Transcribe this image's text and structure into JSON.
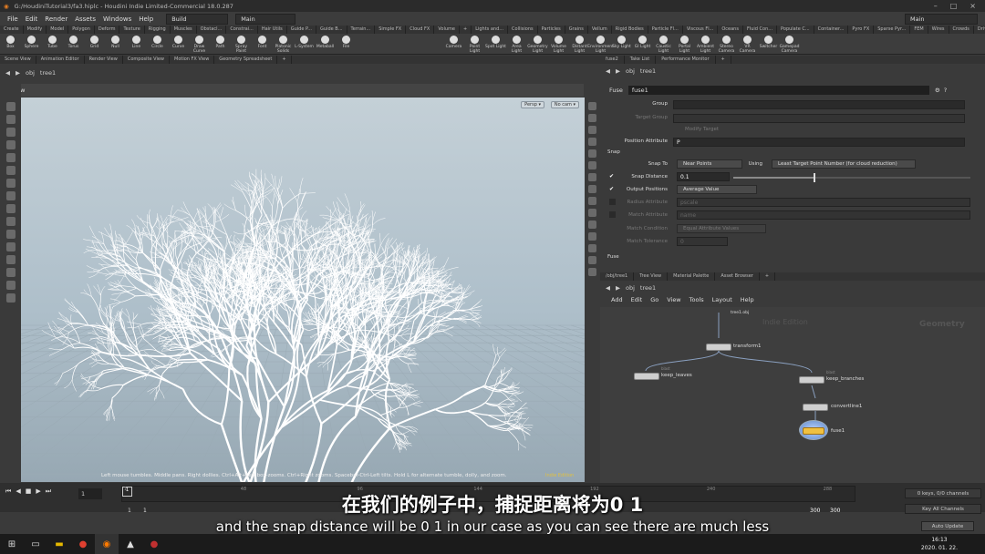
{
  "window": {
    "title": "G:/HoudiniTutorial3/fa3.hiplc - Houdini Indie Limited-Commercial 18.0.287",
    "controls": [
      "–",
      "□",
      "×"
    ]
  },
  "menu": {
    "items": [
      "File",
      "Edit",
      "Render",
      "Assets",
      "Windows",
      "Help"
    ],
    "build": "Build",
    "desktop": "Main",
    "right_desktop": "Main"
  },
  "shelf_tabs": [
    "Create",
    "Modify",
    "Model",
    "Polygon",
    "Deform",
    "Texture",
    "Rigging",
    "Muscles",
    "Obstacl...",
    "Constrai...",
    "Hair Utils",
    "Guide P...",
    "Guide B...",
    "Terrain...",
    "Simple FX",
    "Cloud FX",
    "Volume",
    "+",
    "Lights and...",
    "Collisions",
    "Particles",
    "Grains",
    "Vellum",
    "Rigid Bodies",
    "Particle Fl...",
    "Viscous Fl...",
    "Oceans",
    "Fluid Con...",
    "Populate C...",
    "Container...",
    "Pyro FX",
    "Sparse Pyr...",
    "FEM",
    "Wires",
    "Crowds",
    "Drive Sim..."
  ],
  "shelf_tools_left": [
    "Box",
    "Sphere",
    "Tube",
    "Torus",
    "Grid",
    "Null",
    "Line",
    "Circle",
    "Curve",
    "Draw Curve",
    "Path",
    "Spray Paint",
    "Font",
    "Platonic Solids",
    "L-System",
    "Metaball",
    "File"
  ],
  "shelf_tools_right": [
    "Camera",
    "Point Light",
    "Spot Light",
    "Area Light",
    "Geometry Light",
    "Volume Light",
    "Distant Light",
    "Environment Light",
    "Sky Light",
    "GI Light",
    "Caustic Light",
    "Portal Light",
    "Ambient Light",
    "Stereo Camera",
    "VR Camera",
    "Switcher",
    "Gamepad Camera"
  ],
  "viewer": {
    "tabs": [
      "Scene View",
      "Animation Editor",
      "Render View",
      "Composite View",
      "Motion FX View",
      "Geometry Spreadsheet",
      "+"
    ],
    "path": [
      "obj",
      "tree1"
    ],
    "title": "View",
    "persp": "Persp ▾",
    "cam": "No cam ▾",
    "hint": "Left mouse tumbles. Middle pans. Right dollies. Ctrl+Alt+Left box-zooms. Ctrl+Right zooms. Spacebar-Ctrl-Left tilts. Hold L for alternate tumble, dolly, and zoom.",
    "edition": "Indie Edition"
  },
  "params": {
    "tabs": [
      "fuse2",
      "Take List",
      "Performance Monitor",
      "+"
    ],
    "path": [
      "obj",
      "tree1"
    ],
    "node_type": "Fuse",
    "node_name": "fuse1",
    "rows": [
      {
        "label": "Group",
        "value": "",
        "dim": false
      },
      {
        "label": "Target Group",
        "value": "",
        "dim": true
      },
      {
        "label": "Modify Target",
        "value": "",
        "dim": true
      },
      {
        "label": "Position Attribute",
        "value": "P",
        "dim": false
      }
    ],
    "snap_section": "Snap",
    "snap_to_label": "Snap To",
    "snap_to": "Near Points",
    "using_label": "Using",
    "using": "Least Target Point Number (for cloud reduction)",
    "snap_distance_label": "Snap Distance",
    "snap_distance": "0.1",
    "snap_distance_fraction": 0.34,
    "output_positions_label": "Output Positions",
    "output_positions": "Average Value",
    "radius_label": "Radius Attribute",
    "radius": "pscale",
    "match_label": "Match Attribute",
    "match": "name",
    "match_cond_label": "Match Condition",
    "match_cond": "Equal Attribute Values",
    "match_tol_label": "Match Tolerance",
    "match_tol": "0",
    "fuse_section": "Fuse"
  },
  "network": {
    "tabs": [
      "/obj/tree1",
      "Tree View",
      "Material Palette",
      "Asset Browser",
      "+"
    ],
    "path": [
      "obj",
      "tree1"
    ],
    "menu": [
      "Add",
      "Edit",
      "Go",
      "View",
      "Tools",
      "Layout",
      "Help"
    ],
    "watermark1": "Indie Edition",
    "watermark2": "Geometry",
    "nodes": {
      "top": "tree1.obj",
      "transform": "transform1",
      "leaves": "keep_leaves",
      "branches": "keep_branches",
      "convert": "convertline1",
      "fuse": "fuse1",
      "leaves_type": "blast",
      "branches_type": "blast"
    }
  },
  "timeline": {
    "frame": "1",
    "start": "1",
    "end": "1",
    "end_frame": "300",
    "end_frame2": "300",
    "ticks": [
      "1",
      "48",
      "96",
      "144",
      "192",
      "240",
      "288"
    ],
    "keys": "0 keys, 0/0 channels",
    "key_channels": "Key All Channels",
    "auto_update": "Auto Update"
  },
  "subtitles": {
    "zh": "在我们的例子中，捕捉距离将为0 1",
    "en": "and the snap distance will be 0 1 in our case as you can see there are much less"
  },
  "taskbar": {
    "time": "16:13",
    "date": "2020. 01. 22."
  }
}
